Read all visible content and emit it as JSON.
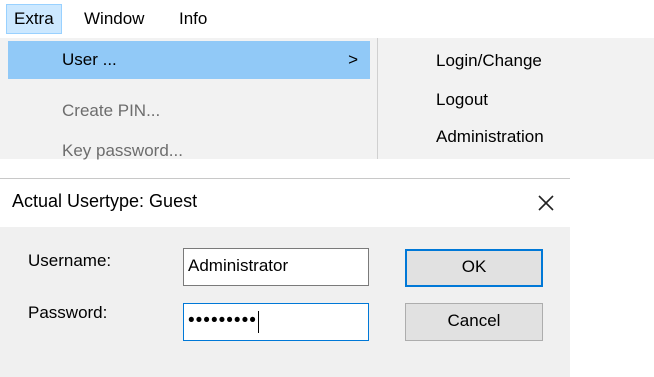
{
  "menubar": {
    "items": [
      {
        "label": "Extra"
      },
      {
        "label": "Window"
      },
      {
        "label": "Info"
      }
    ]
  },
  "dropdown": {
    "items": [
      {
        "label": "User ...",
        "submenu_indicator": ">"
      },
      {
        "label": "Create PIN..."
      },
      {
        "label": "Key password..."
      }
    ]
  },
  "submenu": {
    "items": [
      {
        "label": "Login/Change"
      },
      {
        "label": "Logout"
      },
      {
        "label": "Administration"
      }
    ]
  },
  "dialog": {
    "title": "Actual Usertype: Guest",
    "close_icon": "close-icon",
    "username_label": "Username:",
    "username_value": "Administrator",
    "password_label": "Password:",
    "password_value": "•••••••••",
    "ok_label": "OK",
    "cancel_label": "Cancel"
  },
  "colors": {
    "menu_highlight": "#91c9f7",
    "menu_active_top": "#cce8ff",
    "focus_blue": "#0078d7",
    "menu_background": "#f2f2f2",
    "dialog_background": "#f0f0f0"
  }
}
